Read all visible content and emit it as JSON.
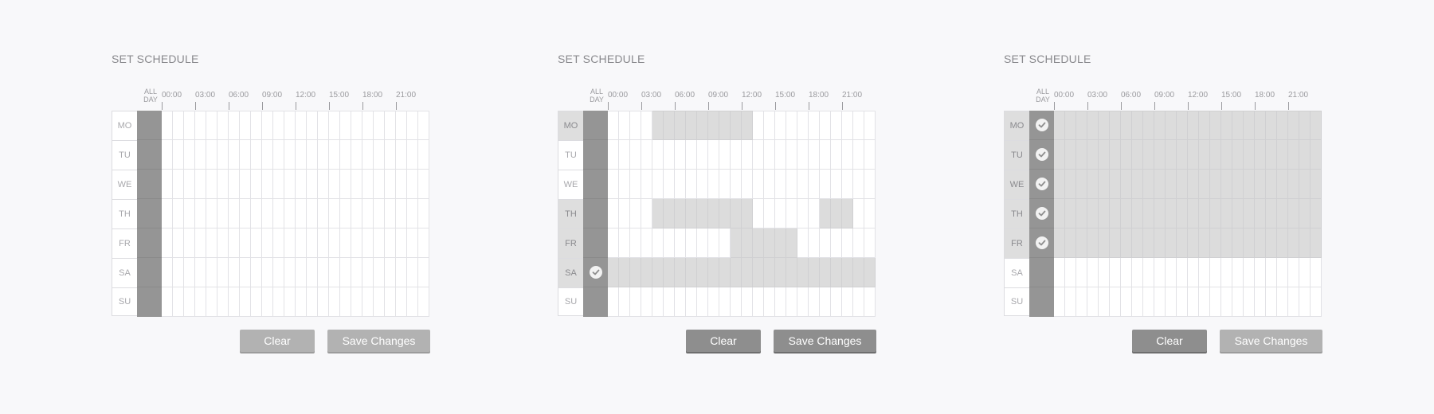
{
  "colors": {
    "background": "#f8f8fa",
    "allday_column": "#959595",
    "selected_cell": "#dcdcdc",
    "button_enabled": "#8e8e8e",
    "button_disabled": "#b2b2b2"
  },
  "panels": [
    {
      "title": "SET SCHEDULE",
      "all_day_label": "ALL DAY",
      "time_labels": [
        "00:00",
        "03:00",
        "06:00",
        "09:00",
        "12:00",
        "15:00",
        "18:00",
        "21:00"
      ],
      "days": [
        {
          "label": "MO",
          "all_day": false,
          "active": false,
          "hours": []
        },
        {
          "label": "TU",
          "all_day": false,
          "active": false,
          "hours": []
        },
        {
          "label": "WE",
          "all_day": false,
          "active": false,
          "hours": []
        },
        {
          "label": "TH",
          "all_day": false,
          "active": false,
          "hours": []
        },
        {
          "label": "FR",
          "all_day": false,
          "active": false,
          "hours": []
        },
        {
          "label": "SA",
          "all_day": false,
          "active": false,
          "hours": []
        },
        {
          "label": "SU",
          "all_day": false,
          "active": false,
          "hours": []
        }
      ],
      "clear_label": "Clear",
      "clear_enabled": false,
      "save_label": "Save Changes",
      "save_enabled": false
    },
    {
      "title": "SET SCHEDULE",
      "all_day_label": "ALL DAY",
      "time_labels": [
        "00:00",
        "03:00",
        "06:00",
        "09:00",
        "12:00",
        "15:00",
        "18:00",
        "21:00"
      ],
      "days": [
        {
          "label": "MO",
          "all_day": false,
          "active": true,
          "hours": [
            4,
            5,
            6,
            7,
            8,
            9,
            10,
            11,
            12
          ]
        },
        {
          "label": "TU",
          "all_day": false,
          "active": false,
          "hours": []
        },
        {
          "label": "WE",
          "all_day": false,
          "active": false,
          "hours": []
        },
        {
          "label": "TH",
          "all_day": false,
          "active": true,
          "hours": [
            4,
            5,
            6,
            7,
            8,
            9,
            10,
            11,
            12,
            19,
            20,
            21
          ]
        },
        {
          "label": "FR",
          "all_day": false,
          "active": true,
          "hours": [
            11,
            12,
            13,
            14,
            15,
            16
          ]
        },
        {
          "label": "SA",
          "all_day": true,
          "active": true,
          "hours": [
            0,
            1,
            2,
            3,
            4,
            5,
            6,
            7,
            8,
            9,
            10,
            11,
            12,
            13,
            14,
            15,
            16,
            17,
            18,
            19,
            20,
            21,
            22,
            23
          ]
        },
        {
          "label": "SU",
          "all_day": false,
          "active": false,
          "hours": []
        }
      ],
      "clear_label": "Clear",
      "clear_enabled": true,
      "save_label": "Save Changes",
      "save_enabled": true
    },
    {
      "title": "SET SCHEDULE",
      "all_day_label": "ALL DAY",
      "time_labels": [
        "00:00",
        "03:00",
        "06:00",
        "09:00",
        "12:00",
        "15:00",
        "18:00",
        "21:00"
      ],
      "days": [
        {
          "label": "MO",
          "all_day": true,
          "active": true,
          "hours": [
            0,
            1,
            2,
            3,
            4,
            5,
            6,
            7,
            8,
            9,
            10,
            11,
            12,
            13,
            14,
            15,
            16,
            17,
            18,
            19,
            20,
            21,
            22,
            23
          ]
        },
        {
          "label": "TU",
          "all_day": true,
          "active": true,
          "hours": [
            0,
            1,
            2,
            3,
            4,
            5,
            6,
            7,
            8,
            9,
            10,
            11,
            12,
            13,
            14,
            15,
            16,
            17,
            18,
            19,
            20,
            21,
            22,
            23
          ]
        },
        {
          "label": "WE",
          "all_day": true,
          "active": true,
          "hours": [
            0,
            1,
            2,
            3,
            4,
            5,
            6,
            7,
            8,
            9,
            10,
            11,
            12,
            13,
            14,
            15,
            16,
            17,
            18,
            19,
            20,
            21,
            22,
            23
          ]
        },
        {
          "label": "TH",
          "all_day": true,
          "active": true,
          "hours": [
            0,
            1,
            2,
            3,
            4,
            5,
            6,
            7,
            8,
            9,
            10,
            11,
            12,
            13,
            14,
            15,
            16,
            17,
            18,
            19,
            20,
            21,
            22,
            23
          ]
        },
        {
          "label": "FR",
          "all_day": true,
          "active": true,
          "hours": [
            0,
            1,
            2,
            3,
            4,
            5,
            6,
            7,
            8,
            9,
            10,
            11,
            12,
            13,
            14,
            15,
            16,
            17,
            18,
            19,
            20,
            21,
            22,
            23
          ]
        },
        {
          "label": "SA",
          "all_day": false,
          "active": false,
          "hours": []
        },
        {
          "label": "SU",
          "all_day": false,
          "active": false,
          "hours": []
        }
      ],
      "clear_label": "Clear",
      "clear_enabled": true,
      "save_label": "Save Changes",
      "save_enabled": false
    }
  ]
}
